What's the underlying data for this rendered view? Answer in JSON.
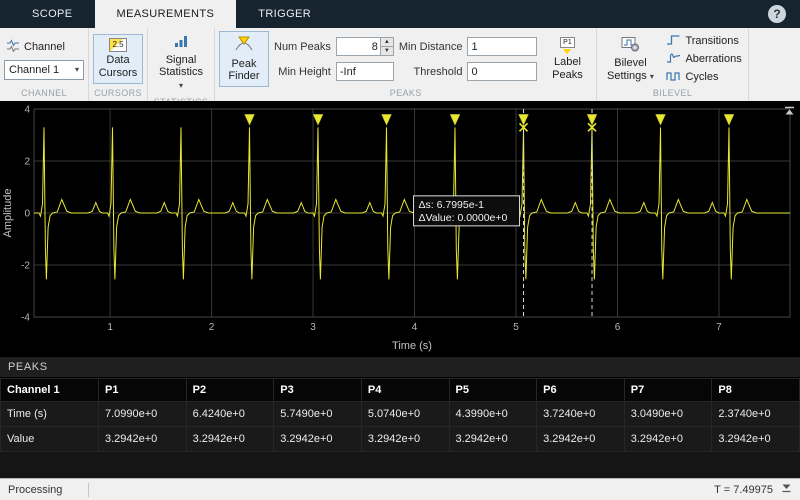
{
  "tabs": {
    "items": [
      {
        "label": "SCOPE"
      },
      {
        "label": "MEASUREMENTS"
      },
      {
        "label": "TRIGGER"
      }
    ],
    "active": "MEASUREMENTS"
  },
  "icons": {
    "help": "?",
    "chevron_down": "▾",
    "spinner_up": "▲",
    "spinner_down": "▼"
  },
  "toolbar": {
    "channel": {
      "button_label": "Channel",
      "selected_channel": "Channel 1",
      "section_label": "CHANNEL"
    },
    "cursors": {
      "button_label": "Data Cursors",
      "icon_text": "2.5",
      "section_label": "CURSORS"
    },
    "statistics": {
      "button_label": "Signal Statistics",
      "section_label": "STATISTICS"
    },
    "peaks": {
      "peak_finder_label": "Peak Finder",
      "num_peaks_label": "Num Peaks",
      "num_peaks_value": "8",
      "min_height_label": "Min Height",
      "min_height_value": "-Inf",
      "min_distance_label": "Min Distance",
      "min_distance_value": "1",
      "threshold_label": "Threshold",
      "threshold_value": "0",
      "label_peaks_label": "Label Peaks",
      "label_peaks_icon_text": "P1",
      "section_label": "PEAKS"
    },
    "bilevel": {
      "settings_label": "Bilevel Settings",
      "transitions_label": "Transitions",
      "aberrations_label": "Aberrations",
      "cycles_label": "Cycles",
      "section_label": "BILEVEL"
    }
  },
  "chart_data": {
    "type": "line",
    "title": "",
    "xlabel": "Time (s)",
    "ylabel": "Amplitude",
    "xlim": [
      0.25,
      7.7
    ],
    "ylim": [
      -4,
      4
    ],
    "xticks": [
      1,
      2,
      3,
      4,
      5,
      6,
      7
    ],
    "yticks": [
      -4,
      -2,
      0,
      2,
      4
    ],
    "grid": true,
    "background": "#000000",
    "signal_color": "#e8e832",
    "beat_period": 0.675,
    "beat_times": [
      0.349,
      1.024,
      1.699,
      2.374,
      3.049,
      3.724,
      4.399,
      5.074,
      5.749,
      6.424,
      7.099
    ],
    "peak_value": 3.2942,
    "marker_times": [
      2.374,
      3.049,
      3.724,
      4.399,
      5.074,
      5.749,
      6.424,
      7.099
    ],
    "cursor_times": [
      5.074,
      5.749
    ],
    "cursor_label_lines": [
      "Δs: 6.7995e-1",
      "ΔValue: 0.0000e+0"
    ]
  },
  "peaks_panel": {
    "title": "PEAKS",
    "table": {
      "headers": [
        "Channel 1",
        "P1",
        "P2",
        "P3",
        "P4",
        "P5",
        "P6",
        "P7",
        "P8"
      ],
      "rows": [
        {
          "label": "Time (s)",
          "values": [
            "7.0990e+0",
            "6.4240e+0",
            "5.7490e+0",
            "5.0740e+0",
            "4.3990e+0",
            "3.7240e+0",
            "3.0490e+0",
            "2.3740e+0"
          ]
        },
        {
          "label": "Value",
          "values": [
            "3.2942e+0",
            "3.2942e+0",
            "3.2942e+0",
            "3.2942e+0",
            "3.2942e+0",
            "3.2942e+0",
            "3.2942e+0",
            "3.2942e+0"
          ]
        }
      ]
    }
  },
  "statusbar": {
    "left": "Processing",
    "right": "T = 7.49975"
  }
}
